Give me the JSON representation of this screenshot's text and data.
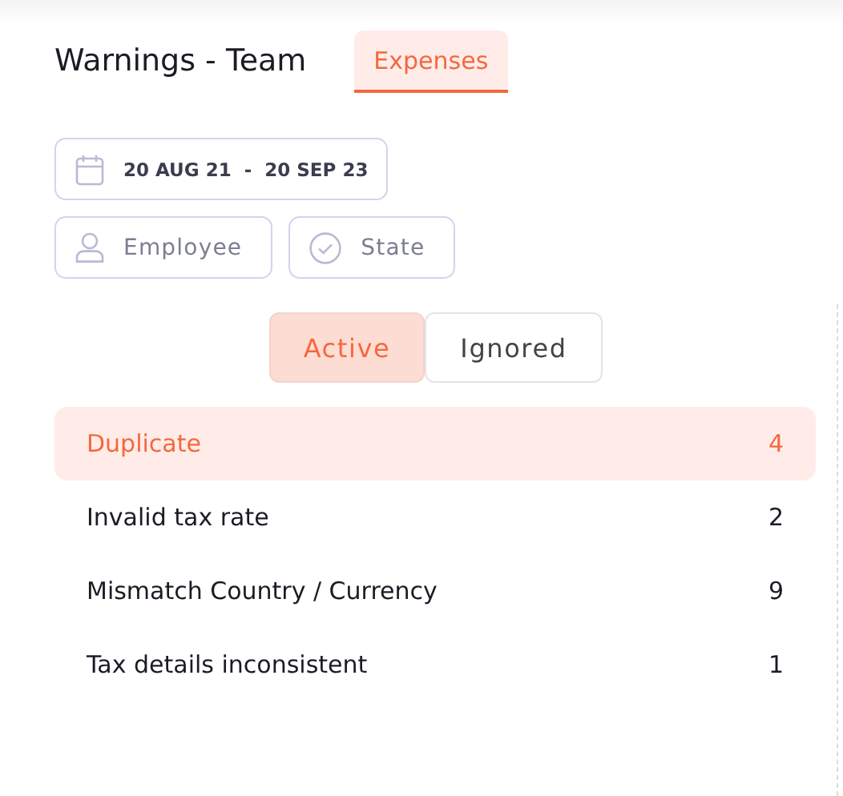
{
  "header": {
    "title": "Warnings - Team",
    "tabs": [
      {
        "label": "Expenses",
        "selected": true
      }
    ]
  },
  "filters": {
    "date_range": {
      "start": "20 AUG 21",
      "separator": "-",
      "end": "20 SEP 23"
    },
    "buttons": [
      {
        "kind": "person",
        "label": "Employee"
      },
      {
        "kind": "check",
        "label": "State"
      }
    ]
  },
  "status_toggle": [
    {
      "label": "Active",
      "selected": true
    },
    {
      "label": "Ignored",
      "selected": false
    }
  ],
  "warnings": [
    {
      "label": "Duplicate",
      "count": "4",
      "selected": true
    },
    {
      "label": "Invalid tax rate",
      "count": "2",
      "selected": false
    },
    {
      "label": "Mismatch Country / Currency",
      "count": "9",
      "selected": false
    },
    {
      "label": "Tax details inconsistent",
      "count": "1",
      "selected": false
    }
  ]
}
